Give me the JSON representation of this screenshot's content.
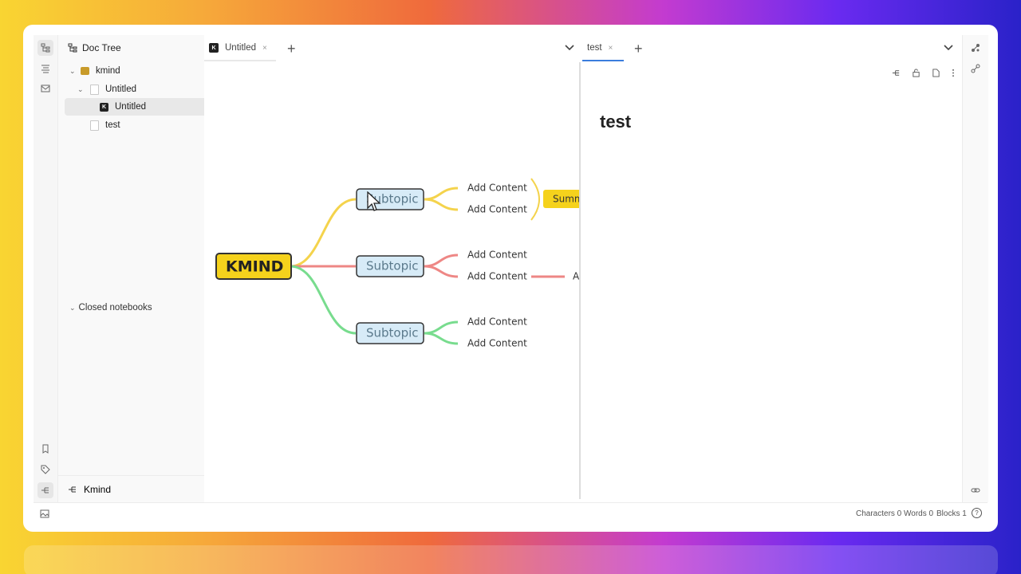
{
  "sidebar": {
    "title": "Doc Tree",
    "notebook": "kmind",
    "items": [
      {
        "label": "Untitled"
      },
      {
        "label": "Untitled"
      },
      {
        "label": "test"
      }
    ],
    "closed_notebooks": "Closed notebooks",
    "plugin_label": "Kmind"
  },
  "left_tabs": [
    {
      "label": "Untitled",
      "close": "×"
    }
  ],
  "right_tabs": [
    {
      "label": "test",
      "close": "×"
    }
  ],
  "tab_add": "+",
  "tab_menu": "⌄",
  "mindmap": {
    "root": "KMIND",
    "subtopics": [
      "Subtopic",
      "Subtopic",
      "Subtopic"
    ],
    "content": [
      "Add Content",
      "Add Content",
      "Add Content",
      "Add Content",
      "Add Content",
      "Add Content"
    ],
    "summary": "Summ",
    "partial_label": "A",
    "colors": {
      "root_fill": "#f5d21c",
      "sub_fill": "#d7ebf7",
      "yellow": "#f4d34c",
      "red": "#ee8785",
      "green": "#78dc8e"
    }
  },
  "document": {
    "heading": "test"
  },
  "status": {
    "characters": "Characters 0",
    "words": "Words 0",
    "blocks": "Blocks 1",
    "help": "?"
  }
}
